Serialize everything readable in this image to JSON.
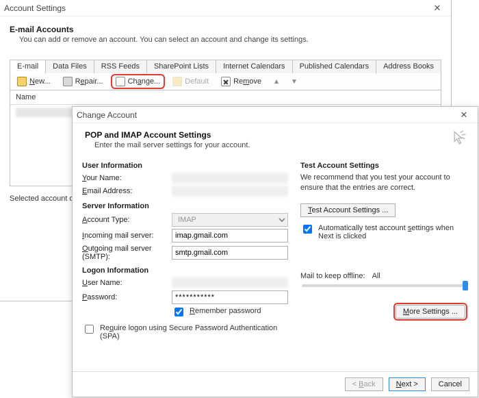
{
  "settings": {
    "title": "Account Settings",
    "heading": "E-mail Accounts",
    "subheading": "You can add or remove an account. You can select an account and change its settings.",
    "tabs": [
      "E-mail",
      "Data Files",
      "RSS Feeds",
      "SharePoint Lists",
      "Internet Calendars",
      "Published Calendars",
      "Address Books"
    ],
    "toolbar": {
      "new": "New...",
      "repair": "Repair...",
      "change": "Change...",
      "default": "Default",
      "remove": "Remove"
    },
    "list": {
      "header": "Name"
    },
    "footer": "Selected account de"
  },
  "change": {
    "title": "Change Account",
    "header_title": "POP and IMAP Account Settings",
    "header_sub": "Enter the mail server settings for your account.",
    "sections": {
      "user": "User Information",
      "server": "Server Information",
      "logon": "Logon Information",
      "test": "Test Account Settings"
    },
    "labels": {
      "your_name": "Your Name:",
      "email": "Email Address:",
      "account_type": "Account Type:",
      "incoming": "Incoming mail server:",
      "outgoing": "Outgoing mail server (SMTP):",
      "user_name": "User Name:",
      "password": "Password:",
      "remember": "Remember password",
      "spa": "Require logon using Secure Password Authentication (SPA)",
      "test_text": "We recommend that you test your account to ensure that the entries are correct.",
      "test_btn": "Test Account Settings ...",
      "auto_test": "Automatically test account settings when Next is clicked",
      "mail_offline": "Mail to keep offline:",
      "offline_val": "All",
      "more": "More Settings ..."
    },
    "values": {
      "account_type": "IMAP",
      "incoming": "imap.gmail.com",
      "outgoing": "smtp.gmail.com",
      "password": "***********"
    },
    "buttons": {
      "back": "< Back",
      "next": "Next >",
      "cancel": "Cancel"
    }
  }
}
